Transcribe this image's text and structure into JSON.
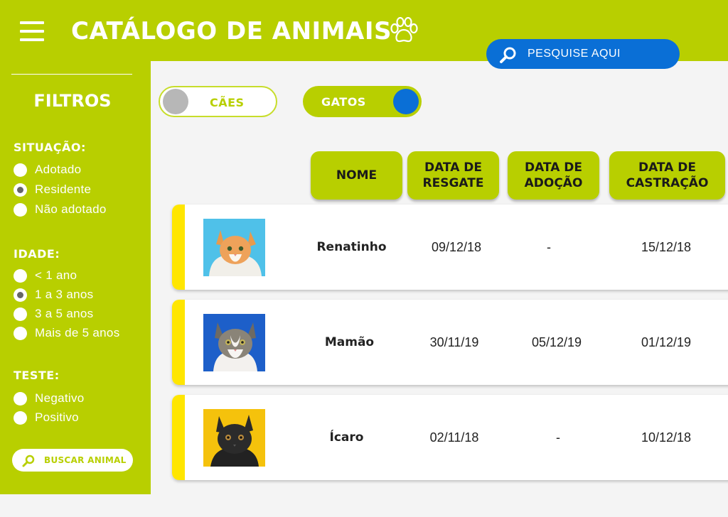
{
  "header": {
    "title": "CATÁLOGO DE ANIMAIS",
    "search_placeholder": "PESQUISE AQUI",
    "brand_color": "#b8cf00",
    "accent_color": "#0a6fd6"
  },
  "sidebar": {
    "title": "FILTROS",
    "sections": [
      {
        "title": "SITUAÇÃO:",
        "options": [
          {
            "label": "Adotado",
            "selected": false
          },
          {
            "label": "Residente",
            "selected": true
          },
          {
            "label": "Não adotado",
            "selected": false
          }
        ]
      },
      {
        "title": "IDADE:",
        "options": [
          {
            "label": "< 1 ano",
            "selected": false
          },
          {
            "label": "1 a 3 anos",
            "selected": true
          },
          {
            "label": "3 a 5 anos",
            "selected": false
          },
          {
            "label": "Mais de 5 anos",
            "selected": false
          }
        ]
      },
      {
        "title": "TESTE:",
        "options": [
          {
            "label": "Negativo",
            "selected": false
          },
          {
            "label": "Positivo",
            "selected": false
          }
        ]
      }
    ],
    "search_button": "BUSCAR ANIMAL"
  },
  "species_toggles": [
    {
      "label": "CÃES",
      "active": false
    },
    {
      "label": "GATOS",
      "active": true
    }
  ],
  "table": {
    "columns": [
      "NOME",
      "DATA DE RESGATE",
      "DATA DE ADOÇÃO",
      "DATA DE CASTRAÇÃO"
    ],
    "rows": [
      {
        "name": "Renatinho",
        "rescue": "09/12/18",
        "adoption": "-",
        "castration": "15/12/18",
        "photo_bg": "#4fc1e9"
      },
      {
        "name": "Mamão",
        "rescue": "30/11/19",
        "adoption": "05/12/19",
        "castration": "01/12/19",
        "photo_bg": "#1d5fc9"
      },
      {
        "name": "Ícaro",
        "rescue": "02/11/18",
        "adoption": "-",
        "castration": "10/12/18",
        "photo_bg": "#f5c20c"
      }
    ]
  }
}
